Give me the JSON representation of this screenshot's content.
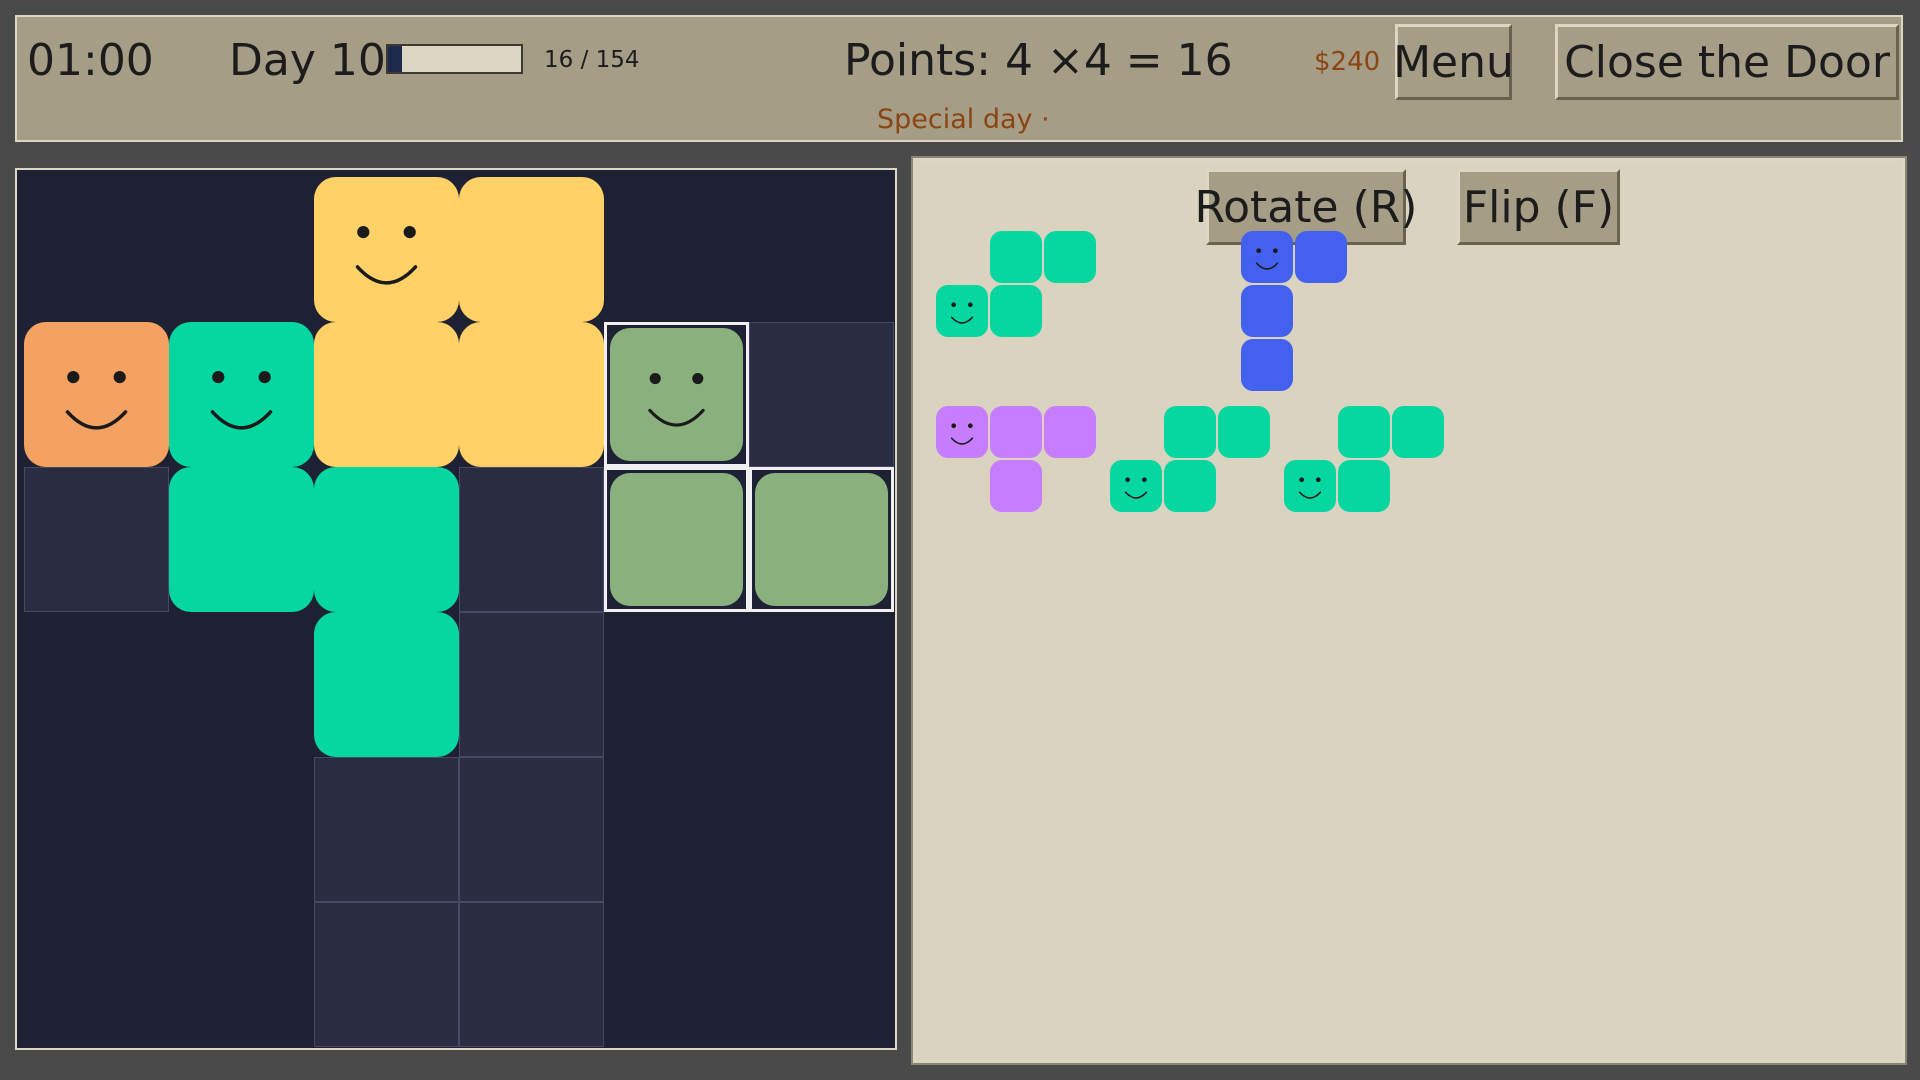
{
  "header": {
    "time": "01:00",
    "day_label": "Day 10",
    "progress": {
      "current": 16,
      "total": 154,
      "text": "16 / 154"
    },
    "points_label": "Points: 4 ×4 = 16",
    "money": "$240",
    "special_label": "Special day ·",
    "menu_label": "Menu",
    "close_label": "Close the Door"
  },
  "tray": {
    "rotate_label": "Rotate (R)",
    "flip_label": "Flip (F)"
  },
  "colors": {
    "yellow": "#ffd166",
    "orange": "#f4a261",
    "teal": "#06d6a0",
    "sage": "#8ab17d",
    "blue": "#4361ee",
    "purple": "#c77dff",
    "board_bg": "#1e2033",
    "empty_cell": "#2a2d42"
  },
  "board": {
    "cols": 6,
    "rows": 6,
    "cells": [
      {
        "r": 0,
        "c": 2,
        "type": "block",
        "color": "yellow",
        "face": true
      },
      {
        "r": 0,
        "c": 3,
        "type": "block",
        "color": "yellow",
        "face": false
      },
      {
        "r": 1,
        "c": 0,
        "type": "block",
        "color": "orange",
        "face": true
      },
      {
        "r": 1,
        "c": 1,
        "type": "block",
        "color": "teal",
        "face": true
      },
      {
        "r": 1,
        "c": 2,
        "type": "block",
        "color": "yellow",
        "face": false
      },
      {
        "r": 1,
        "c": 3,
        "type": "block",
        "color": "yellow",
        "face": false
      },
      {
        "r": 1,
        "c": 4,
        "type": "block",
        "color": "sage",
        "face": true,
        "selected": true
      },
      {
        "r": 1,
        "c": 5,
        "type": "empty"
      },
      {
        "r": 2,
        "c": 0,
        "type": "empty"
      },
      {
        "r": 2,
        "c": 1,
        "type": "block",
        "color": "teal",
        "face": false
      },
      {
        "r": 2,
        "c": 2,
        "type": "block",
        "color": "teal",
        "face": false
      },
      {
        "r": 2,
        "c": 3,
        "type": "empty"
      },
      {
        "r": 2,
        "c": 4,
        "type": "block",
        "color": "sage",
        "face": false,
        "selected": true
      },
      {
        "r": 2,
        "c": 5,
        "type": "block",
        "color": "sage",
        "face": false,
        "selected": true
      },
      {
        "r": 3,
        "c": 2,
        "type": "block",
        "color": "teal",
        "face": false
      },
      {
        "r": 3,
        "c": 3,
        "type": "empty"
      },
      {
        "r": 4,
        "c": 2,
        "type": "empty"
      },
      {
        "r": 4,
        "c": 3,
        "type": "empty"
      },
      {
        "r": 5,
        "c": 2,
        "type": "empty"
      },
      {
        "r": 5,
        "c": 3,
        "type": "empty"
      }
    ]
  },
  "pieces": [
    {
      "name": "teal-s-piece-1",
      "color": "teal",
      "face": [
        1,
        0
      ],
      "cells": [
        [
          0,
          1
        ],
        [
          0,
          2
        ],
        [
          1,
          0
        ],
        [
          1,
          1
        ]
      ]
    },
    {
      "name": "blue-j-piece",
      "color": "blue",
      "face": [
        0,
        0
      ],
      "cells": [
        [
          0,
          0
        ],
        [
          0,
          1
        ],
        [
          1,
          0
        ],
        [
          2,
          0
        ]
      ]
    },
    {
      "name": "purple-t-piece",
      "color": "purple",
      "face": [
        0,
        0
      ],
      "cells": [
        [
          0,
          0
        ],
        [
          0,
          1
        ],
        [
          0,
          2
        ],
        [
          1,
          1
        ]
      ]
    },
    {
      "name": "teal-s-piece-2",
      "color": "teal",
      "face": [
        1,
        0
      ],
      "cells": [
        [
          0,
          1
        ],
        [
          0,
          2
        ],
        [
          1,
          0
        ],
        [
          1,
          1
        ]
      ]
    },
    {
      "name": "teal-s-piece-3",
      "color": "teal",
      "face": [
        1,
        0
      ],
      "cells": [
        [
          0,
          1
        ],
        [
          0,
          2
        ],
        [
          1,
          0
        ],
        [
          1,
          1
        ]
      ]
    }
  ]
}
